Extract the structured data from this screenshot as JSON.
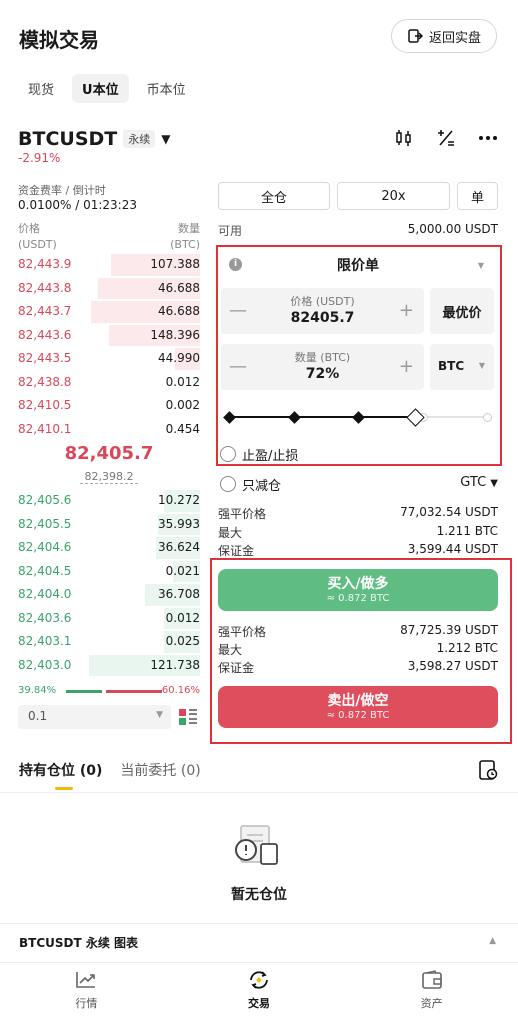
{
  "header": {
    "title": "模拟交易",
    "back_label": "返回实盘"
  },
  "tabs": [
    "现货",
    "U本位",
    "币本位"
  ],
  "symbol": {
    "name": "BTCUSDT",
    "badge": "永续",
    "change": "-2.91%"
  },
  "funding": {
    "label": "资金费率 / 倒计时",
    "value": "0.0100% / 01:23:23"
  },
  "orderbook": {
    "price_header": "价格",
    "price_unit": "(USDT)",
    "qty_header": "数量",
    "qty_unit": "(BTC)",
    "asks": [
      {
        "price": "82,443.9",
        "qty": "107.388",
        "depth": 0.49
      },
      {
        "price": "82,443.8",
        "qty": "46.688",
        "depth": 0.56
      },
      {
        "price": "82,443.7",
        "qty": "46.688",
        "depth": 0.6
      },
      {
        "price": "82,443.6",
        "qty": "148.396",
        "depth": 0.5
      },
      {
        "price": "82,443.5",
        "qty": "44.990",
        "depth": 0.14
      },
      {
        "price": "82,438.8",
        "qty": "0.012",
        "depth": 0
      },
      {
        "price": "82,410.5",
        "qty": "0.002",
        "depth": 0
      },
      {
        "price": "82,410.1",
        "qty": "0.454",
        "depth": 0
      }
    ],
    "mid_price": "82,405.7",
    "mark_price": "82,398.2",
    "bids": [
      {
        "price": "82,405.6",
        "qty": "10.272",
        "depth": 0.2
      },
      {
        "price": "82,405.5",
        "qty": "35.993",
        "depth": 0.23
      },
      {
        "price": "82,404.6",
        "qty": "36.624",
        "depth": 0.24
      },
      {
        "price": "82,404.5",
        "qty": "0.021",
        "depth": 0.15
      },
      {
        "price": "82,404.0",
        "qty": "36.708",
        "depth": 0.3
      },
      {
        "price": "82,403.6",
        "qty": "0.012",
        "depth": 0.2
      },
      {
        "price": "82,403.1",
        "qty": "0.025",
        "depth": 0.2
      },
      {
        "price": "82,403.0",
        "qty": "121.738",
        "depth": 0.61
      }
    ],
    "buy_ratio": "39.84%",
    "sell_ratio": "60.16%",
    "precision": "0.1"
  },
  "controls": {
    "margin_mode": "全仓",
    "leverage": "20x",
    "position_mode": "单"
  },
  "available": {
    "label": "可用",
    "value": "5,000.00 USDT"
  },
  "order": {
    "type": "限价单",
    "price_label": "价格 (USDT)",
    "price_value": "82405.7",
    "best_price": "最优价",
    "qty_label": "数量 (BTC)",
    "qty_value": "72%",
    "qty_unit": "BTC",
    "slider_fraction": 0.72,
    "tpsl_label": "止盈/止损",
    "reduce_only_label": "只减仓",
    "tif": "GTC"
  },
  "buy_info": {
    "liq_label": "强平价格",
    "liq_value": "77,032.54 USDT",
    "max_label": "最大",
    "max_value": "1.211 BTC",
    "margin_label": "保证金",
    "margin_value": "3,599.44 USDT"
  },
  "buy_button": {
    "label": "买入/做多",
    "sub": "≈ 0.872 BTC"
  },
  "sell_info": {
    "liq_label": "强平价格",
    "liq_value": "87,725.39 USDT",
    "max_label": "最大",
    "max_value": "1.212 BTC",
    "margin_label": "保证金",
    "margin_value": "3,598.27 USDT"
  },
  "sell_button": {
    "label": "卖出/做空",
    "sub": "≈ 0.872 BTC"
  },
  "positions": {
    "tab_holdings": "持有仓位",
    "holdings_count": "(0)",
    "tab_orders": "当前委托",
    "orders_count": "(0)",
    "empty": "暂无仓位"
  },
  "chart_bar": {
    "label": "BTCUSDT 永续 图表"
  },
  "nav": [
    "行情",
    "交易",
    "资产"
  ],
  "colors": {
    "red": "#d9485a",
    "green": "#3aa46b",
    "highlight": "#e0313a"
  }
}
